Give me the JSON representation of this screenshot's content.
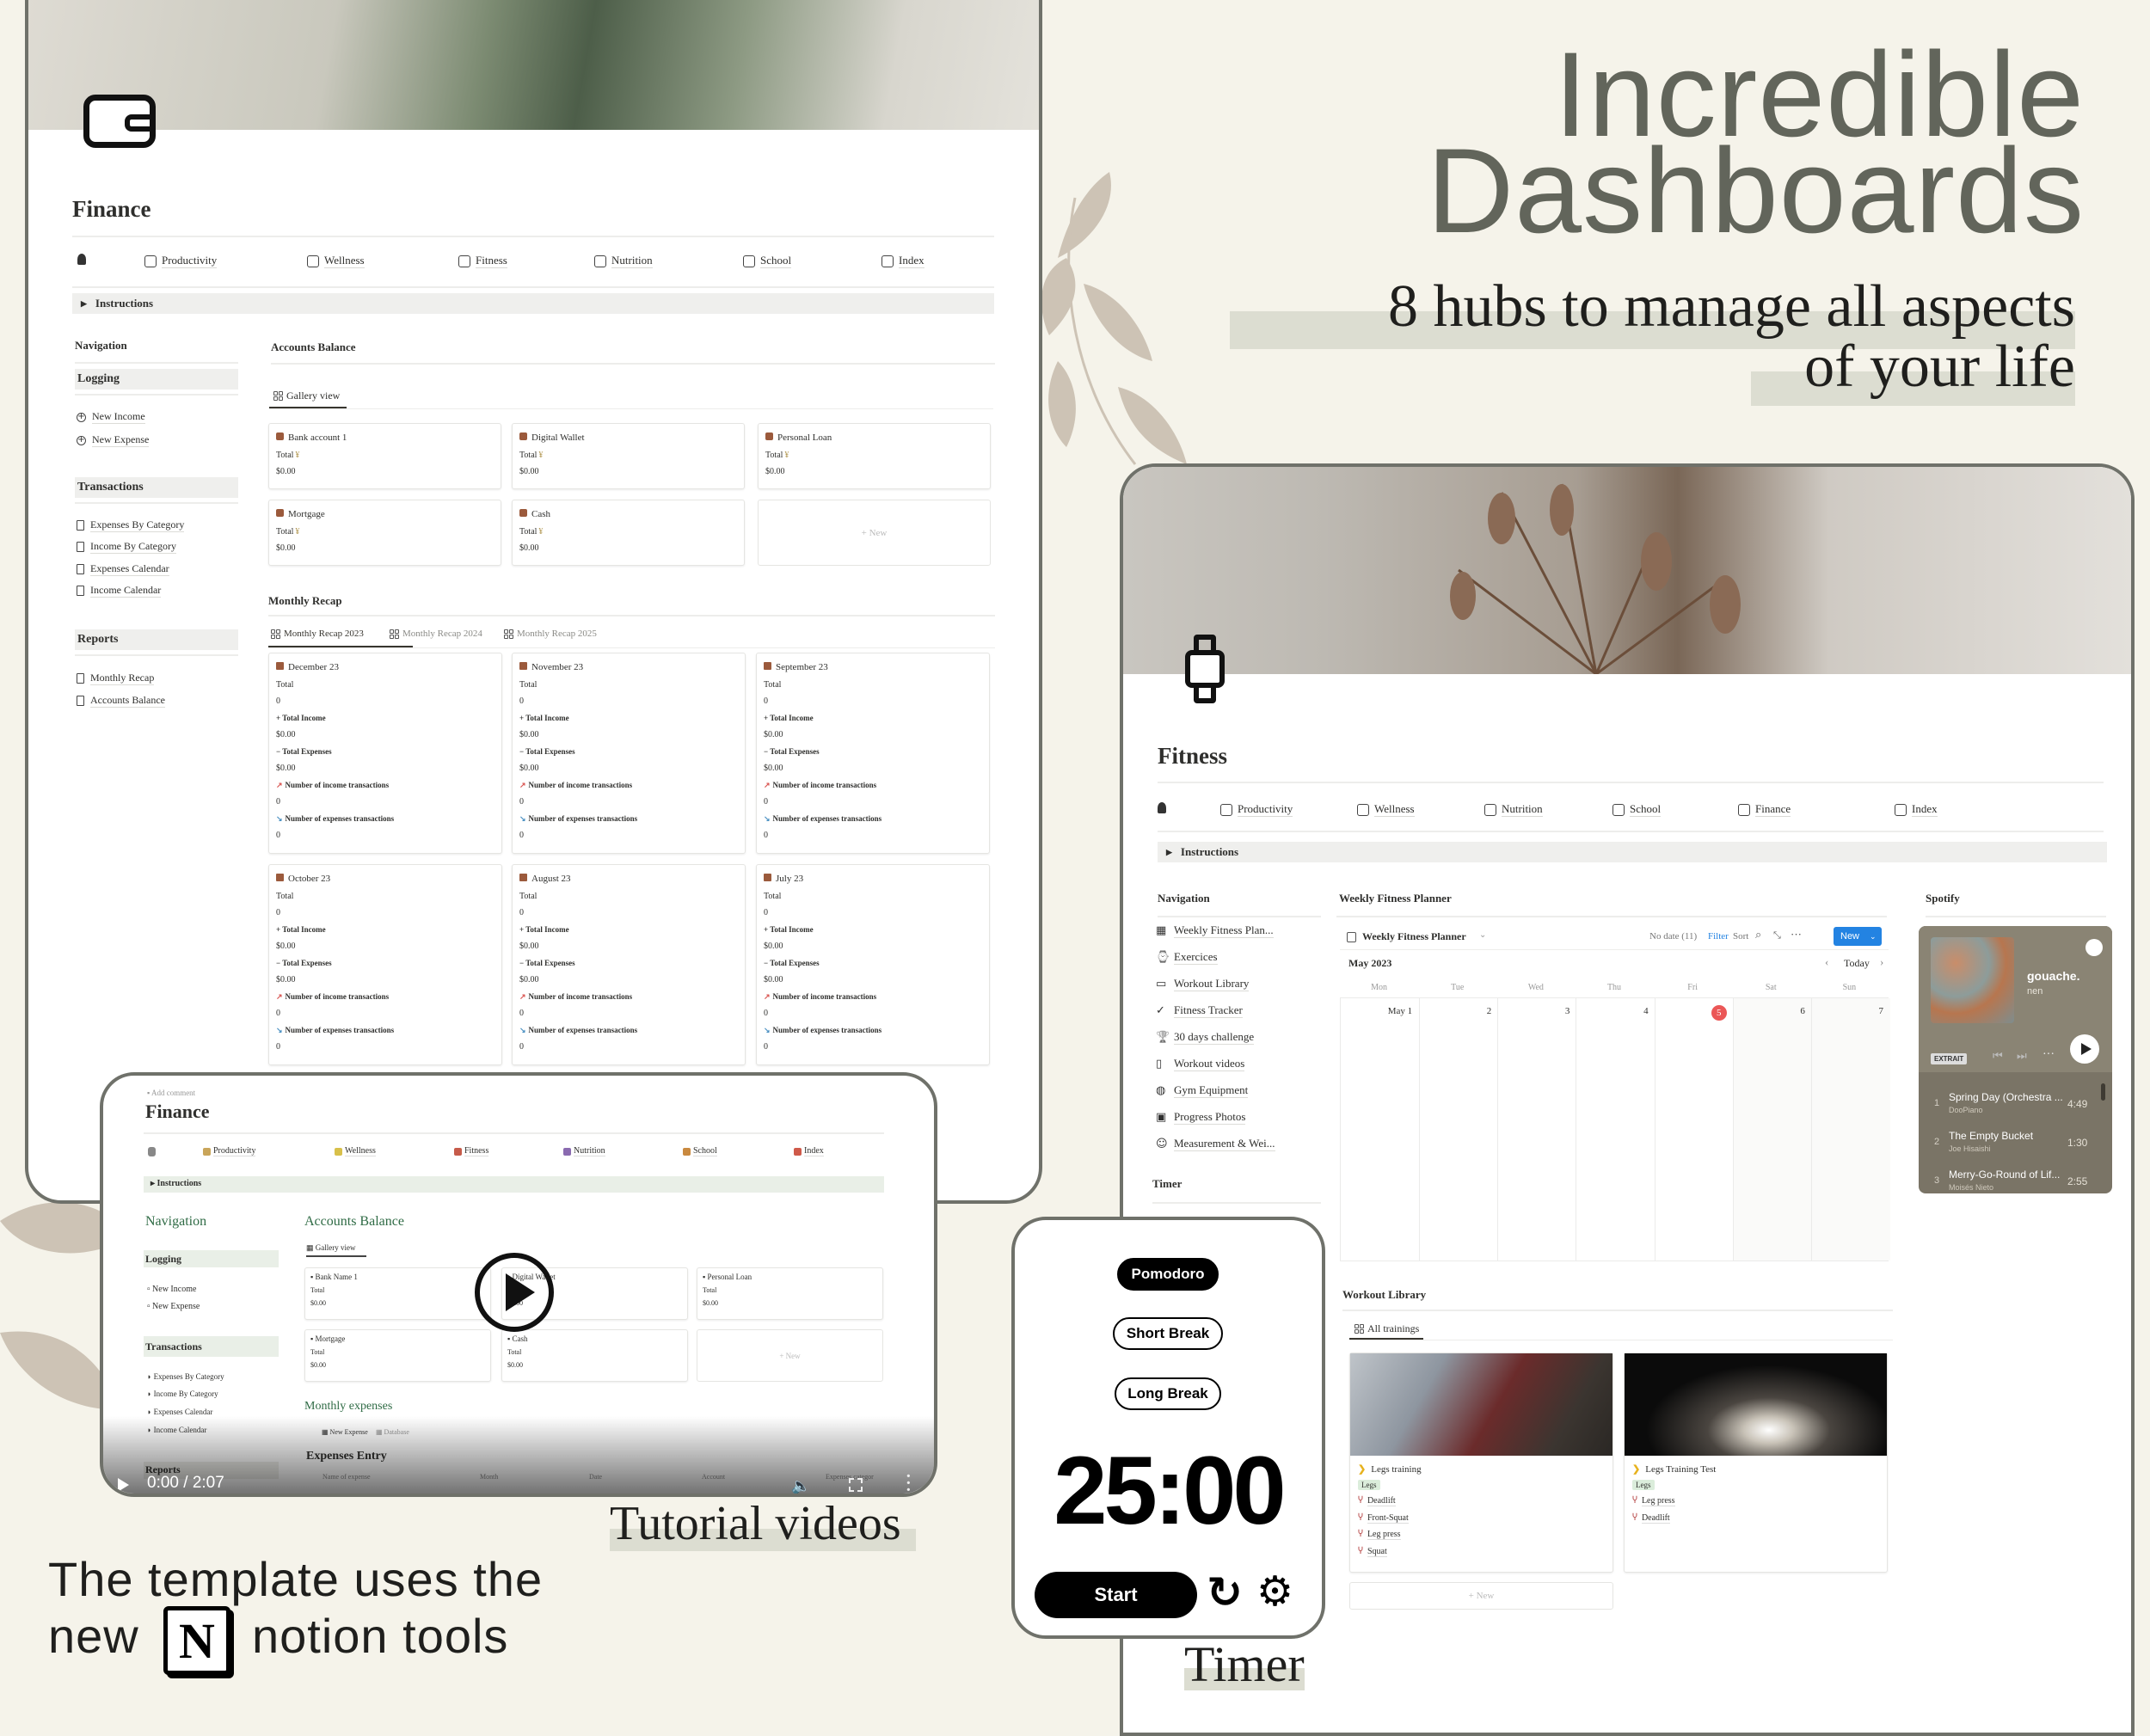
{
  "headline": {
    "line1": "Incredible",
    "line2": "Dashboards",
    "sub1": "8 hubs to manage all aspects",
    "sub2": "of your life"
  },
  "captions": {
    "tutorial": "Tutorial videos",
    "timer": "Timer",
    "template_line1": "The template uses the",
    "template_new": "new",
    "template_tools": "notion tools",
    "notion_logo": "N"
  },
  "colors": {
    "background": "#f5f3ea",
    "panel_border": "#6f716a",
    "headline": "#62655b",
    "highlight": "#dcddd1",
    "accent_blue": "#2383e2",
    "today_red": "#eb5757",
    "spotify_bg": "#7a7466",
    "video_green": "#2f6b45"
  },
  "finance": {
    "title": "Finance",
    "cover_icon": "wallet-icon",
    "nav": [
      {
        "icon": "avatar-icon",
        "label": ""
      },
      {
        "icon": "productivity-icon",
        "label": "Productivity"
      },
      {
        "icon": "wellness-icon",
        "label": "Wellness"
      },
      {
        "icon": "fitness-icon",
        "label": "Fitness"
      },
      {
        "icon": "nutrition-icon",
        "label": "Nutrition"
      },
      {
        "icon": "school-icon",
        "label": "School"
      },
      {
        "icon": "index-icon",
        "label": "Index"
      }
    ],
    "instructions": "Instructions",
    "sidebar": {
      "navigation": "Navigation",
      "groups": [
        {
          "title": "Logging",
          "items": [
            "New Income",
            "New Expense"
          ]
        },
        {
          "title": "Transactions",
          "items": [
            "Expenses By Category",
            "Income By Category",
            "Expenses Calendar",
            "Income Calendar"
          ]
        },
        {
          "title": "Reports",
          "items": [
            "Monthly Recap",
            "Accounts Balance"
          ]
        }
      ]
    },
    "accounts": {
      "title": "Accounts Balance",
      "view": "Gallery view",
      "cards": [
        {
          "name": "Bank account 1",
          "label": "Total",
          "value": "$0.00"
        },
        {
          "name": "Digital Wallet",
          "label": "Total",
          "value": "$0.00"
        },
        {
          "name": "Personal Loan",
          "label": "Total",
          "value": "$0.00"
        },
        {
          "name": "Mortgage",
          "label": "Total",
          "value": "$0.00"
        },
        {
          "name": "Cash",
          "label": "Total",
          "value": "$0.00"
        }
      ],
      "new_label": "+ New"
    },
    "recap": {
      "title": "Monthly Recap",
      "tabs": [
        "Monthly Recap 2023",
        "Monthly Recap 2024",
        "Monthly Recap 2025"
      ],
      "fields": [
        "Total",
        "+ Total Income",
        "− Total Expenses",
        "Number of income transactions",
        "Number of expenses transactions"
      ],
      "cards": [
        {
          "month": "December 23",
          "values": [
            "0",
            "$0.00",
            "$0.00",
            "0",
            "0"
          ]
        },
        {
          "month": "November 23",
          "values": [
            "0",
            "$0.00",
            "$0.00",
            "0",
            "0"
          ]
        },
        {
          "month": "September 23",
          "values": [
            "0",
            "$0.00",
            "$0.00",
            "0",
            "0"
          ]
        },
        {
          "month": "October 23",
          "values": [
            "0",
            "$0.00",
            "$0.00",
            "0",
            "0"
          ]
        },
        {
          "month": "August 23",
          "values": [
            "0",
            "$0.00",
            "$0.00",
            "0",
            "0"
          ]
        },
        {
          "month": "July 23",
          "values": [
            "0",
            "$0.00",
            "$0.00",
            "0",
            "0"
          ]
        }
      ]
    }
  },
  "video": {
    "add_comment": "Add comment",
    "title": "Finance",
    "nav": [
      "Productivity",
      "Wellness",
      "Fitness",
      "Nutrition",
      "School",
      "Index"
    ],
    "instructions": "Instructions",
    "navigation": "Navigation",
    "logging": "Logging",
    "logging_items": [
      "New Income",
      "New Expense"
    ],
    "transactions": "Transactions",
    "transactions_items": [
      "Expenses By Category",
      "Income By Category",
      "Expenses Calendar",
      "Income Calendar"
    ],
    "reports": "Reports",
    "accounts_title": "Accounts Balance",
    "view": "Gallery view",
    "cards": [
      {
        "name": "Bank Name 1",
        "label": "Total",
        "value": "$0.00"
      },
      {
        "name": "Digital Wallet",
        "label": "Total",
        "value": "$0.00"
      },
      {
        "name": "Personal Loan",
        "label": "Total",
        "value": "$0.00"
      },
      {
        "name": "Mortgage",
        "label": "Total",
        "value": "$0.00"
      },
      {
        "name": "Cash",
        "label": "Total",
        "value": "$0.00"
      }
    ],
    "new_label": "+ New",
    "monthly_expenses": "Monthly expenses",
    "expense_tabs": [
      "New Expense",
      "Database"
    ],
    "expenses_entry": "Expenses Entry",
    "columns": [
      "Name of expense",
      "Month",
      "Date",
      "Account",
      "Expenses categor"
    ],
    "time": "0:00 / 2:07",
    "progress": 0
  },
  "fitness": {
    "title": "Fitness",
    "cover_icon": "smartwatch-icon",
    "nav": [
      {
        "icon": "avatar-icon",
        "label": ""
      },
      {
        "icon": "productivity-icon",
        "label": "Productivity"
      },
      {
        "icon": "wellness-icon",
        "label": "Wellness"
      },
      {
        "icon": "nutrition-icon",
        "label": "Nutrition"
      },
      {
        "icon": "school-icon",
        "label": "School"
      },
      {
        "icon": "finance-icon",
        "label": "Finance"
      },
      {
        "icon": "index-icon",
        "label": "Index"
      }
    ],
    "instructions": "Instructions",
    "navigation": "Navigation",
    "nav_items": [
      {
        "icon": "calendar-icon",
        "label": "Weekly Fitness Plan..."
      },
      {
        "icon": "watch-icon",
        "label": "Exercices"
      },
      {
        "icon": "monitor-icon",
        "label": "Workout Library"
      },
      {
        "icon": "check-icon",
        "label": "Fitness Tracker"
      },
      {
        "icon": "trophy-icon",
        "label": "30 days challenge"
      },
      {
        "icon": "phone-icon",
        "label": "Workout videos"
      },
      {
        "icon": "ball-icon",
        "label": "Gym Equipment"
      },
      {
        "icon": "image-icon",
        "label": "Progress Photos"
      },
      {
        "icon": "smiley-icon",
        "label": "Measurement & Wei..."
      }
    ],
    "timer_heading": "Timer",
    "planner": {
      "title": "Weekly Fitness Planner",
      "view": "Weekly Fitness Planner",
      "no_date": "No date (11)",
      "filter": "Filter",
      "sort": "Sort",
      "new": "New",
      "month": "May 2023",
      "today": "Today",
      "weekdays": [
        "Mon",
        "Tue",
        "Wed",
        "Thu",
        "Fri",
        "Sat",
        "Sun"
      ],
      "days": [
        "May 1",
        "2",
        "3",
        "4",
        "5",
        "6",
        "7"
      ],
      "today_day": "5"
    },
    "spotify": {
      "heading": "Spotify",
      "album": "gouache.",
      "artist": "nen",
      "badge": "EXTRAIT",
      "tracks": [
        {
          "n": "1",
          "title": "Spring Day (Orchestra ...",
          "artist": "DooPiano",
          "duration": "4:49"
        },
        {
          "n": "2",
          "title": "The Empty Bucket",
          "artist": "Joe Hisaishi",
          "duration": "1:30"
        },
        {
          "n": "3",
          "title": "Merry-Go-Round of Lif...",
          "artist": "Moisés Nieto",
          "duration": "2:55"
        }
      ]
    },
    "library": {
      "title": "Workout Library",
      "view": "All trainings",
      "cards": [
        {
          "name": "Legs training",
          "tag": "Legs",
          "exercises": [
            "Deadlift",
            "Front-Squat",
            "Leg press",
            "Squat"
          ]
        },
        {
          "name": "Legs Training Test",
          "tag": "Legs",
          "exercises": [
            "Leg press",
            "Deadlift"
          ]
        }
      ],
      "new_label": "+ New"
    }
  },
  "timer": {
    "modes": [
      "Pomodoro",
      "Short Break",
      "Long Break"
    ],
    "active_mode": "Pomodoro",
    "time": "25:00",
    "start": "Start"
  }
}
